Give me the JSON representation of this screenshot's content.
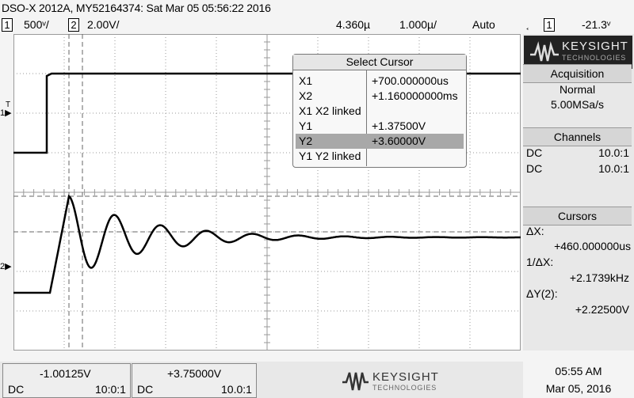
{
  "title": "DSO-X 2012A, MY52164374: Sat Mar 05 05:56:22 2016",
  "status": {
    "ch1_badge": "1",
    "ch1_scale": "500ᵛ/",
    "ch2_badge": "2",
    "ch2_scale": "2.00V/",
    "delay": "4.360µ",
    "timebase": "1.000µ/",
    "trigger_mode": "Auto",
    "trigger_src": "1",
    "trigger_level": "-21.3ᵛ",
    "trigger_icon": "trigger-edge-icon"
  },
  "brand": {
    "name": "KEYSIGHT",
    "sub": "TECHNOLOGIES"
  },
  "acquisition": {
    "title": "Acquisition",
    "mode": "Normal",
    "rate": "5.00MSa/s"
  },
  "channels": {
    "title": "Channels",
    "rows": [
      {
        "coupling": "DC",
        "ratio": "10.0:1"
      },
      {
        "coupling": "DC",
        "ratio": "10.0:1"
      }
    ]
  },
  "cursors": {
    "title": "Cursors",
    "dx_label": "ΔX:",
    "dx_value": "+460.000000us",
    "inv_label": "1/ΔX:",
    "inv_value": "+2.1739kHz",
    "dy_label": "ΔY(2):",
    "dy_value": "+2.22500V"
  },
  "cursor_menu": {
    "title": "Select Cursor",
    "rows": [
      {
        "label": "X1",
        "value": "+700.000000us",
        "selected": false
      },
      {
        "label": "X2",
        "value": "+1.160000000ms",
        "selected": false
      },
      {
        "label": "X1 X2 linked",
        "value": "",
        "selected": false
      },
      {
        "label": "Y1",
        "value": "+1.37500V",
        "selected": false
      },
      {
        "label": "Y2",
        "value": "+3.60000V",
        "selected": true
      },
      {
        "label": "Y1 Y2 linked",
        "value": "",
        "selected": false
      }
    ]
  },
  "bottom": {
    "ch1_readout": "-1.00125V",
    "ch1_coupling": "DC",
    "ch1_ratio": "10:0:1",
    "ch2_readout": "+3.75000V",
    "ch2_coupling": "DC",
    "ch2_ratio": "10.0:1"
  },
  "clock": {
    "time": "05:55 AM",
    "date": "Mar 05, 2016"
  },
  "markers": {
    "ch1": "1",
    "ch2": "2",
    "trigger": "T"
  },
  "colors": {
    "trace": "#000000",
    "grid": "#9a9a9a",
    "selected_row": "#a8a8a8"
  }
}
